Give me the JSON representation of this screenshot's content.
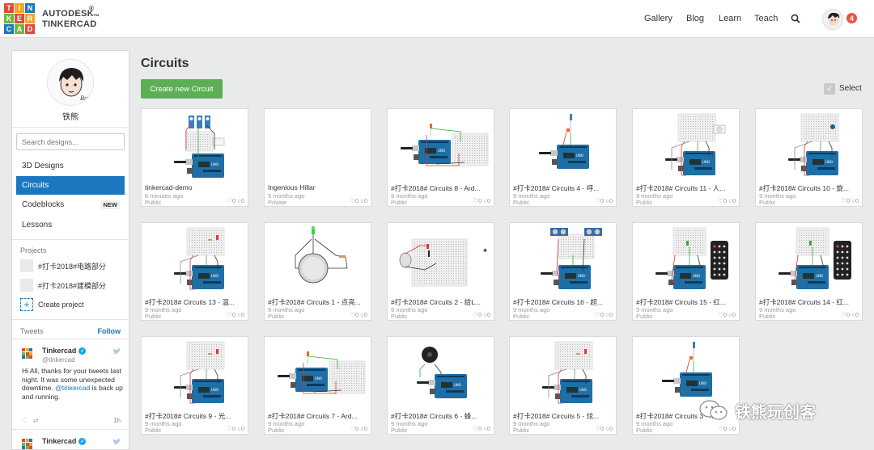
{
  "header": {
    "logo_letters": [
      "T",
      "I",
      "N",
      "K",
      "E",
      "R",
      "C",
      "A",
      "D"
    ],
    "logo_colors": [
      "#e2473f",
      "#f6a623",
      "#1b77c0",
      "#6db83e",
      "#e2473f",
      "#f6a623",
      "#1b77c0",
      "#6db83e",
      "#e2473f"
    ],
    "brand_line1": "AUTODESK",
    "brand_line2": "TINKERCAD",
    "brand_reg": "®",
    "brand_tm": "™",
    "nav": [
      "Gallery",
      "Blog",
      "Learn",
      "Teach"
    ],
    "notification_count": "4"
  },
  "sidebar": {
    "username": "铁熊",
    "search_placeholder": "Search designs...",
    "items": [
      {
        "label": "3D Designs"
      },
      {
        "label": "Circuits"
      },
      {
        "label": "Codeblocks",
        "badge": "NEW"
      },
      {
        "label": "Lessons"
      }
    ],
    "projects_label": "Projects",
    "projects": [
      "#打卡2018#电路部分",
      "#打卡2018#建模部分"
    ],
    "create_project": "Create project",
    "tweets_label": "Tweets",
    "follow_label": "Follow",
    "tweet": {
      "name": "Tinkercad",
      "handle": "@tinkercad",
      "text_before": "Hi All, thanks for your tweets last night. It was some unexpected downtime. ",
      "link": "@tinkercad",
      "text_after": " is back up and running.",
      "time": "1h"
    },
    "tweet2_name": "Tinkercad"
  },
  "main": {
    "title": "Circuits",
    "create_button": "Create new Circuit",
    "select_label": "Select",
    "cards": [
      {
        "title": "tinkercad-demo",
        "time": "6 minutes ago",
        "visibility": "Public",
        "likes": "0",
        "comments": "0",
        "thumb": "sensors"
      },
      {
        "title": "Ingenious Hillar",
        "time": "5 months ago",
        "visibility": "Private",
        "likes": "0",
        "comments": "0",
        "thumb": "blank"
      },
      {
        "title": "#打卡2018# Circuits 8 - Ard...",
        "time": "9 months ago",
        "visibility": "Public",
        "likes": "0",
        "comments": "0",
        "thumb": "arduino-bb-right"
      },
      {
        "title": "#打卡2018# Circuits 4 - 呼...",
        "time": "9 months ago",
        "visibility": "Public",
        "likes": "0",
        "comments": "0",
        "thumb": "arduino-led"
      },
      {
        "title": "#打卡2018# Circuits 11 - 人...",
        "time": "9 months ago",
        "visibility": "Public",
        "likes": "0",
        "comments": "0",
        "thumb": "arduino-bb-top-pir"
      },
      {
        "title": "#打卡2018# Circuits 10 - 旋...",
        "time": "9 months ago",
        "visibility": "Public",
        "likes": "0",
        "comments": "0",
        "thumb": "arduino-bb-top-knob"
      },
      {
        "title": "#打卡2018# Circuits 13 - 温...",
        "time": "9 months ago",
        "visibility": "Public",
        "likes": "0",
        "comments": "0",
        "thumb": "arduino-bb-top"
      },
      {
        "title": "#打卡2018# Circuits 1 - 点亮...",
        "time": "9 months ago",
        "visibility": "Public",
        "likes": "0",
        "comments": "0",
        "thumb": "battery-led"
      },
      {
        "title": "#打卡2018# Circuits 2 - 给L...",
        "time": "9 months ago",
        "visibility": "Public",
        "likes": "0",
        "comments": "0",
        "thumb": "bb-coin"
      },
      {
        "title": "#打卡2018# Circuits 16 - 超...",
        "time": "9 months ago",
        "visibility": "Public",
        "likes": "0",
        "comments": "0",
        "thumb": "arduino-ultrasonic"
      },
      {
        "title": "#打卡2018# Circuits 15 - 红...",
        "time": "9 months ago",
        "visibility": "Public",
        "likes": "0",
        "comments": "0",
        "thumb": "arduino-remote"
      },
      {
        "title": "#打卡2018# Circuits 14 - 红...",
        "time": "9 months ago",
        "visibility": "Public",
        "likes": "0",
        "comments": "0",
        "thumb": "arduino-remote"
      },
      {
        "title": "#打卡2018# Circuits 9 - 光...",
        "time": "9 months ago",
        "visibility": "Public",
        "likes": "0",
        "comments": "0",
        "thumb": "arduino-bb-top"
      },
      {
        "title": "#打卡2018# Circuits 7 - Ard...",
        "time": "9 months ago",
        "visibility": "Public",
        "likes": "0",
        "comments": "0",
        "thumb": "arduino-bb-right"
      },
      {
        "title": "#打卡2018# Circuits 6 - 蜂...",
        "time": "9 months ago",
        "visibility": "Public",
        "likes": "0",
        "comments": "0",
        "thumb": "arduino-buzzer"
      },
      {
        "title": "#打卡2018# Circuits 5 - 炫...",
        "time": "9 months ago",
        "visibility": "Public",
        "likes": "0",
        "comments": "0",
        "thumb": "arduino-bb-top"
      },
      {
        "title": "#打卡2018# Circuits 3 - ...",
        "time": "9 months ago",
        "visibility": "Public",
        "likes": "0",
        "comments": "0",
        "thumb": "arduino-led"
      }
    ]
  },
  "watermark": "铁熊玩创客"
}
